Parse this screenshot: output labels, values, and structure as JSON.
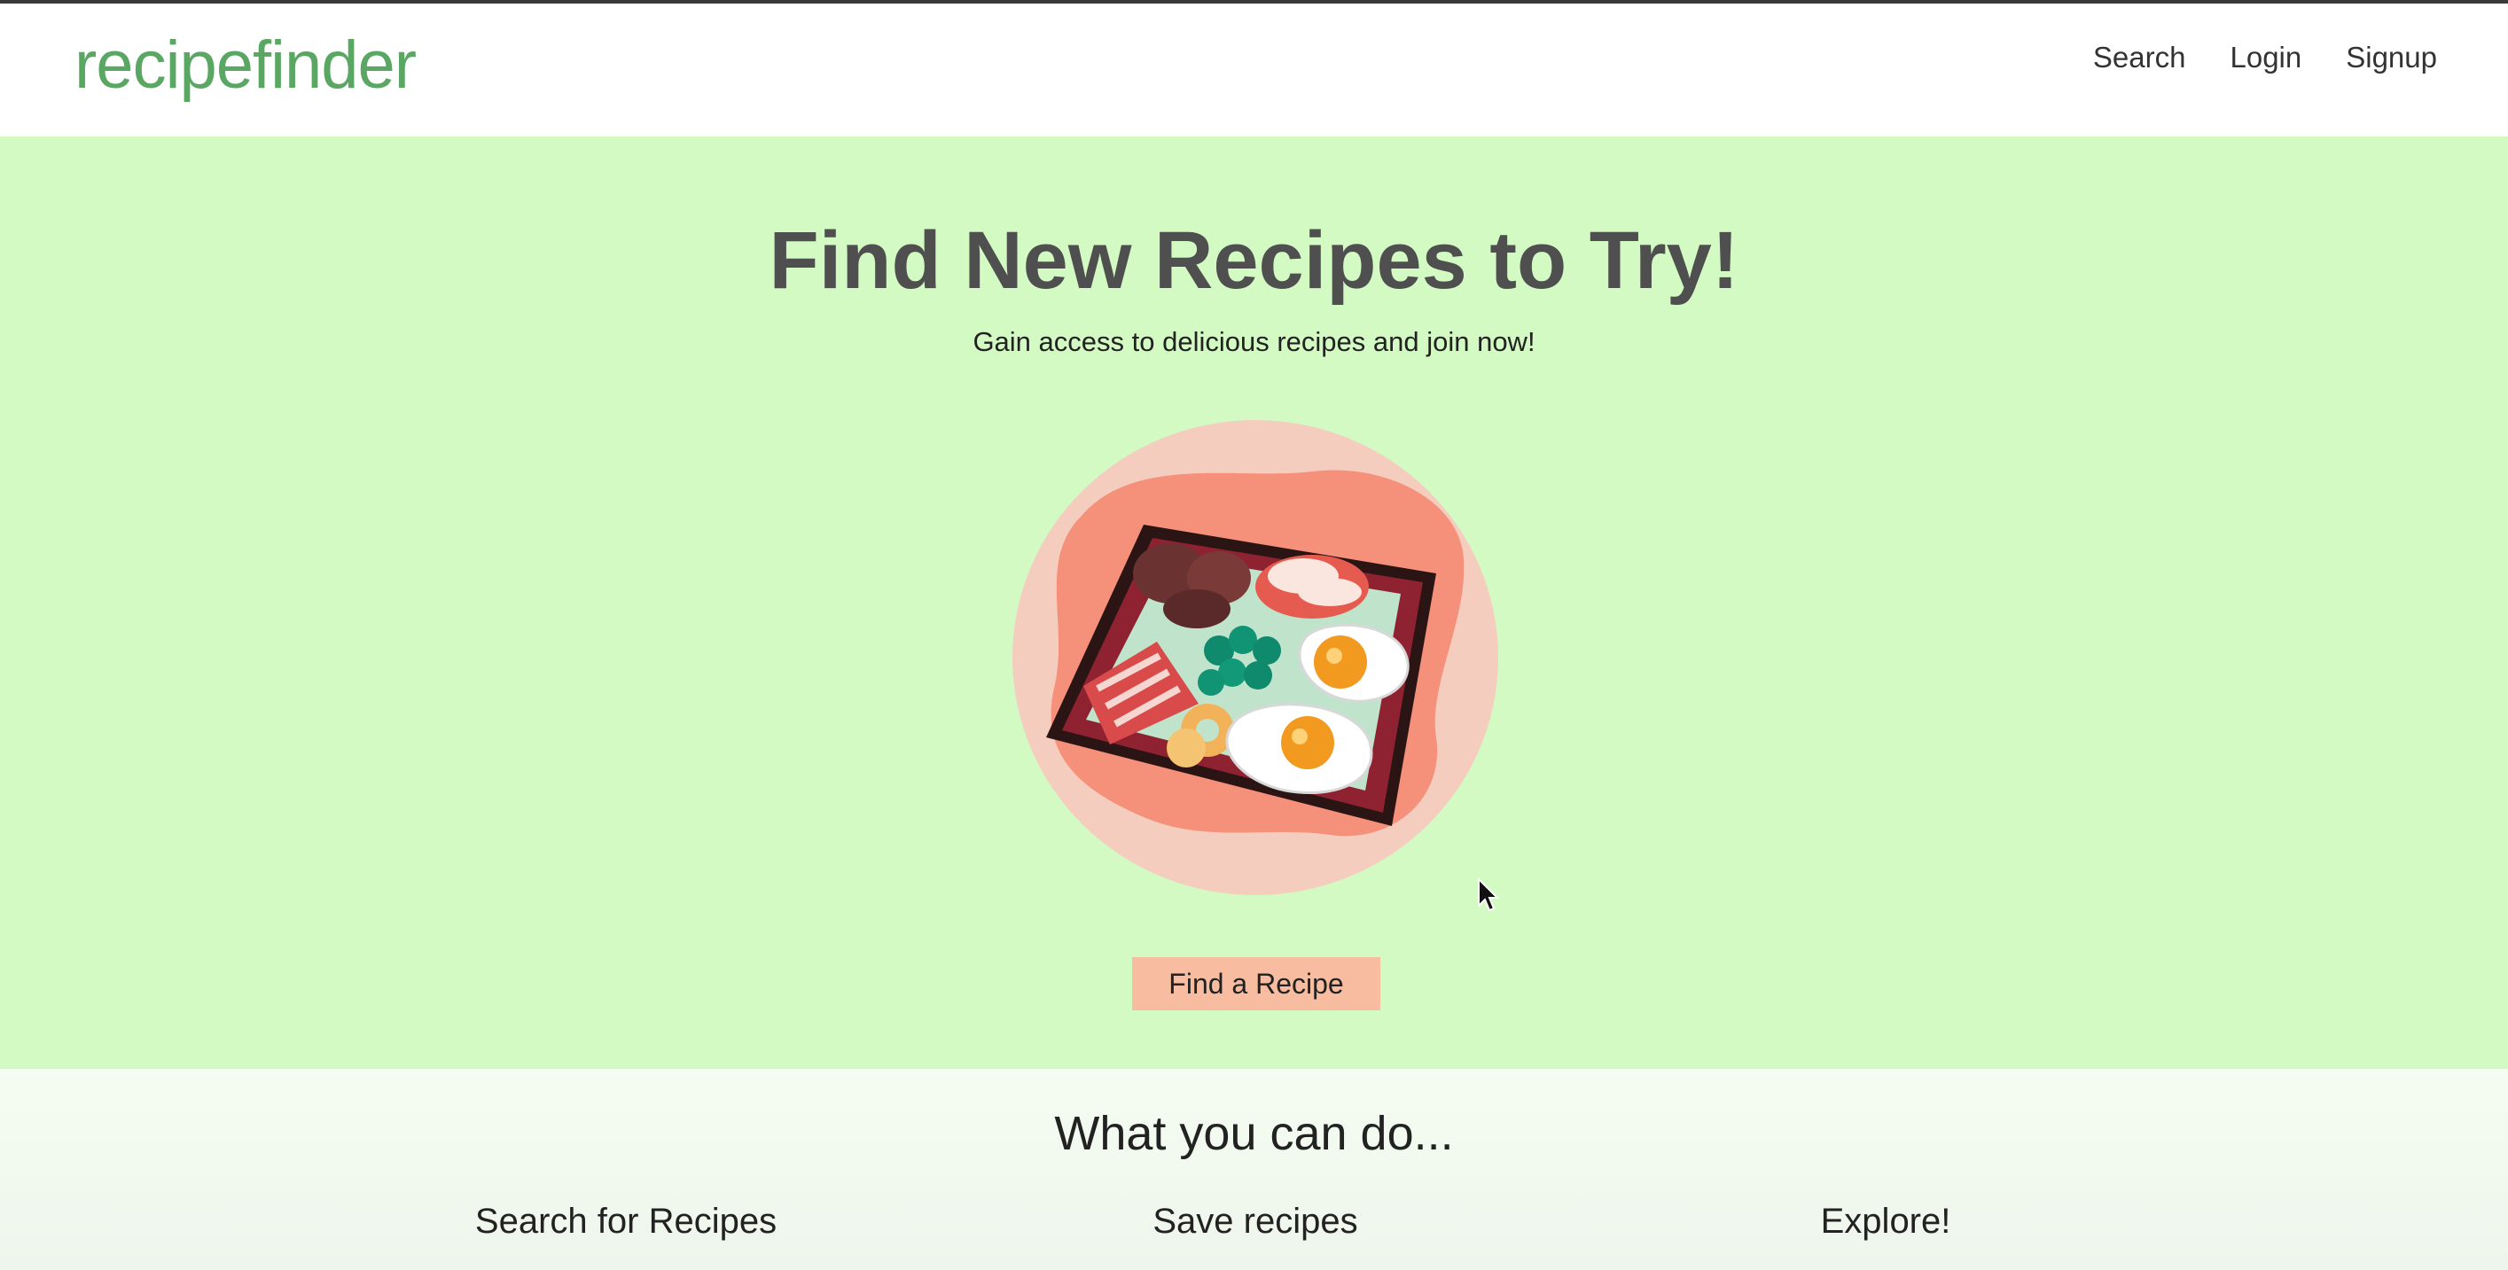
{
  "navbar": {
    "brand": "recipefinder",
    "links": [
      "Search",
      "Login",
      "Signup"
    ]
  },
  "hero": {
    "title": "Find New Recipes to Try!",
    "subtitle": "Gain access to delicious recipes and join now!",
    "button_label": "Find a Recipe"
  },
  "features": {
    "title": "What you can do...",
    "items": [
      "Search for Recipes",
      "Save recipes",
      "Explore!"
    ]
  },
  "colors": {
    "brand": "#5aa763",
    "hero_bg": "#d4fac3",
    "button_bg": "#f8bca0"
  }
}
